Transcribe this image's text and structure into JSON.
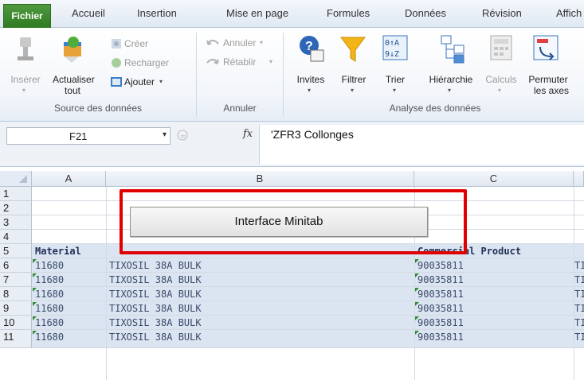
{
  "tabs": [
    "Fichier",
    "Accueil",
    "Insertion",
    "Mise en page",
    "Formules",
    "Données",
    "Révision",
    "Affich"
  ],
  "ribbon": {
    "inserer": "Insérer",
    "actualiser_line1": "Actualiser",
    "actualiser_line2": "tout",
    "creer": "Créer",
    "recharger": "Recharger",
    "ajouter": "Ajouter",
    "group_source": "Source des données",
    "annuler": "Annuler",
    "retablir": "Rétablir",
    "group_annuler": "Annuler",
    "invites": "Invites",
    "filtrer": "Filtrer",
    "trier": "Trier",
    "hierarchie": "Hiérarchie",
    "calculs": "Calculs",
    "permuter_line1": "Permuter",
    "permuter_line2": "les axes",
    "group_analyse": "Analyse des données"
  },
  "formula_bar": {
    "name_box": "F21",
    "fx": "fx",
    "formula": "'ZFR3 Collonges"
  },
  "columns": [
    "A",
    "B",
    "C"
  ],
  "rows": [
    "1",
    "2",
    "3",
    "4",
    "5",
    "6",
    "7",
    "8",
    "9",
    "10",
    "11"
  ],
  "sheet_button": "Interface Minitab",
  "header_row": {
    "material": "Material",
    "commercial_product": "Commercial Product"
  },
  "data_rows": [
    {
      "material": "11680",
      "description": "TIXOSIL 38A BULK",
      "product": "90035811",
      "extra": "TI"
    },
    {
      "material": "11680",
      "description": "TIXOSIL 38A BULK",
      "product": "90035811",
      "extra": "TI"
    },
    {
      "material": "11680",
      "description": "TIXOSIL 38A BULK",
      "product": "90035811",
      "extra": "TI"
    },
    {
      "material": "11680",
      "description": "TIXOSIL 38A BULK",
      "product": "90035811",
      "extra": "TI"
    },
    {
      "material": "11680",
      "description": "TIXOSIL 38A BULK",
      "product": "90035811",
      "extra": "TI"
    },
    {
      "material": "11680",
      "description": "TIXOSIL 38A BULK",
      "product": "90035811",
      "extra": "TI"
    }
  ],
  "colors": {
    "highlight": "#e00000",
    "data_fill": "#dbe5f1",
    "file_tab": "#3a8a2c"
  }
}
